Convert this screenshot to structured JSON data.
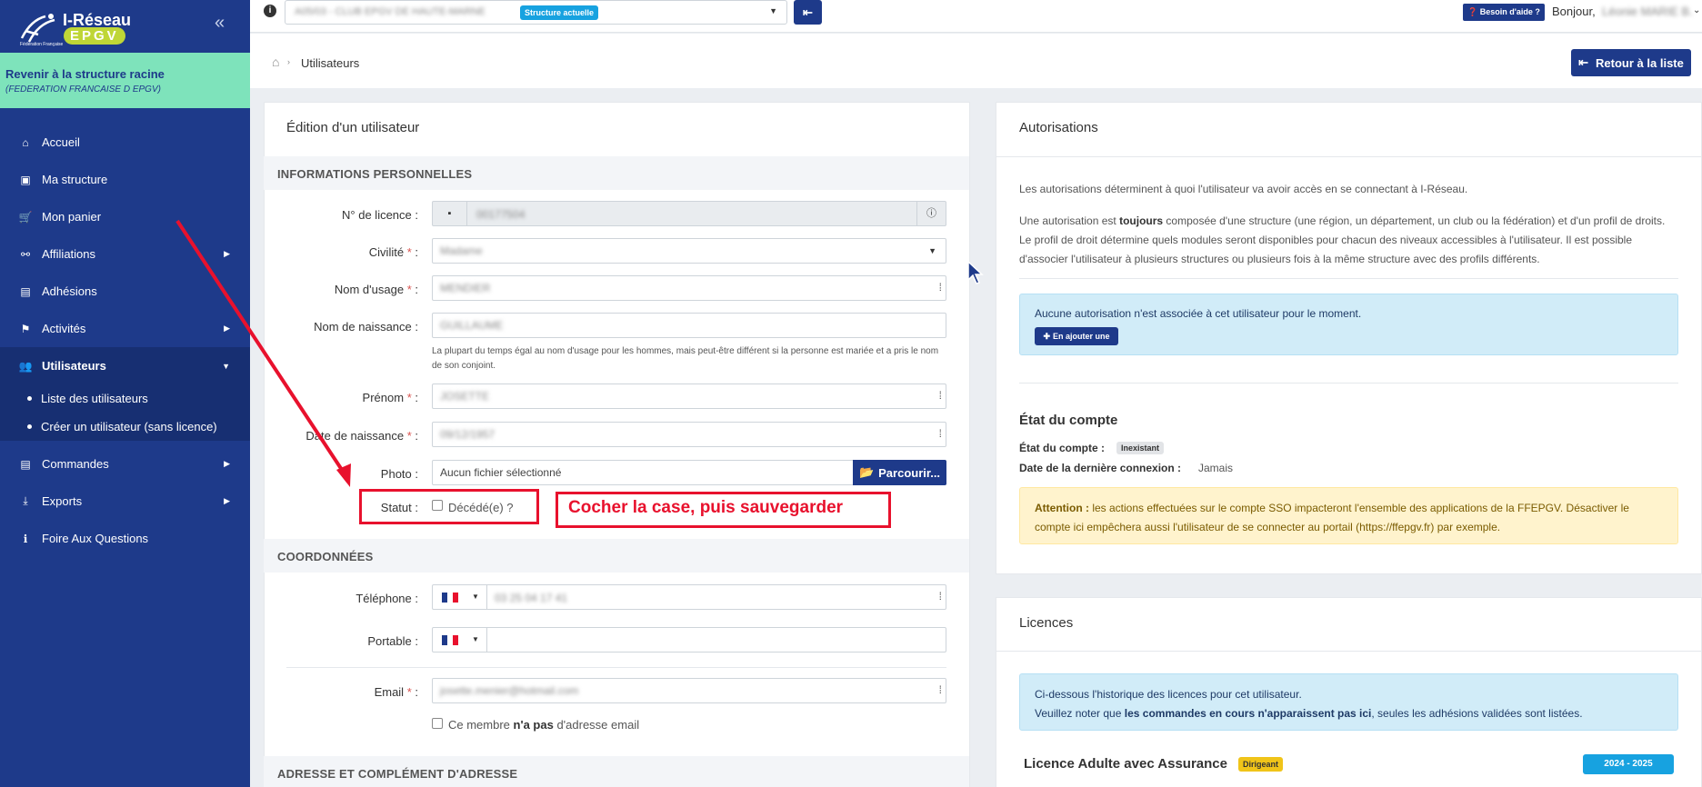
{
  "brand": {
    "name": "I-Réseau",
    "sub": "EPGV",
    "fed": "Fédération Française"
  },
  "sidebar": {
    "back_title": "Revenir à la structure racine",
    "back_sub": "(FEDERATION FRANCAISE D EPGV)",
    "items": [
      {
        "label": "Accueil",
        "icon": "home-icon",
        "glyph": "⌂"
      },
      {
        "label": "Ma structure",
        "icon": "id-card-icon",
        "glyph": "▣"
      },
      {
        "label": "Mon panier",
        "icon": "cart-icon",
        "glyph": "🛒"
      },
      {
        "label": "Affiliations",
        "icon": "sitemap-icon",
        "glyph": "⚯"
      },
      {
        "label": "Adhésions",
        "icon": "card-icon",
        "glyph": "▤"
      },
      {
        "label": "Activités",
        "icon": "running-icon",
        "glyph": "⚑"
      },
      {
        "label": "Utilisateurs",
        "icon": "users-icon",
        "glyph": "👥"
      },
      {
        "label": "Commandes",
        "icon": "list-icon",
        "glyph": "▤"
      },
      {
        "label": "Exports",
        "icon": "download-icon",
        "glyph": "⤓"
      },
      {
        "label": "Foire Aux Questions",
        "icon": "info-icon",
        "glyph": "ℹ"
      }
    ],
    "sub_items": [
      "Liste des utilisateurs",
      "Créer un utilisateur (sans licence)"
    ]
  },
  "topbar": {
    "structure_value": "A05/03 - CLUB EPGV DE HAUTE-MARNE",
    "structure_badge": "Structure actuelle",
    "help_label": "Besoin d'aide ?",
    "greeting": "Bonjour,",
    "user_name": "Léonie MARIE B."
  },
  "breadcrumb": {
    "page": "Utilisateurs"
  },
  "back_to_list": "Retour à la liste",
  "edit": {
    "title": "Édition d'un utilisateur",
    "section_personal": "INFORMATIONS PERSONNELLES",
    "licence_label": "N° de licence :",
    "licence_value": "00177504",
    "civilite_label": "Civilité",
    "civilite_value": "Madame",
    "nom_usage_label": "Nom d'usage",
    "nom_usage_value": "MENDIER",
    "nom_naissance_label": "Nom de naissance :",
    "nom_naissance_value": "GUILLAUME",
    "help_text": "La plupart du temps égal au nom d'usage pour les hommes, mais peut-être différent si la personne est mariée et a pris le nom de son conjoint.",
    "prenom_label": "Prénom",
    "prenom_value": "JOSETTE",
    "naissance_label": "Date de naissance",
    "naissance_value": "09/12/1957",
    "photo_label": "Photo :",
    "photo_value": "Aucun fichier sélectionné",
    "browse_label": "Parcourir...",
    "statut_label": "Statut :",
    "decede_label": "Décédé(e) ?",
    "annotation": "Cocher la case, puis sauvegarder",
    "section_coord": "COORDONNÉES",
    "tel_label": "Téléphone :",
    "tel_value": "03 25 04 17 41",
    "portable_label": "Portable :",
    "email_label": "Email",
    "email_value": "josette.menier@hotmail.com",
    "no_email_pre": "Ce membre",
    "no_email_bold": "n'a pas",
    "no_email_post": "d'adresse email",
    "section_address": "ADRESSE ET COMPLÉMENT D'ADRESSE"
  },
  "auth": {
    "title": "Autorisations",
    "p1": "Les autorisations déterminent à quoi l'utilisateur va avoir accès en se connectant à I-Réseau.",
    "p2a": "Une autorisation est",
    "p2b": "toujours",
    "p2c": "composée d'une structure (une région, un département, un club ou la fédération) et d'un profil de droits. Le profil de droit détermine quels modules seront disponibles pour chacun des niveaux accessibles à l'utilisateur. Il est possible d'associer l'utilisateur à plusieurs structures ou plusieurs fois à la même structure avec des profils différents.",
    "none": "Aucune autorisation n'est associée à cet utilisateur pour le moment.",
    "add": "En ajouter une",
    "account_title": "État du compte",
    "account_state_label": "État du compte :",
    "account_state": "Inexistant",
    "last_login_label": "Date de la dernière connexion :",
    "last_login": "Jamais",
    "warn_bold": "Attention :",
    "warn_text": "les actions effectuées sur le compte SSO impacteront l'ensemble des applications de la FFEPGV. Désactiver le compte ici empêchera aussi l'utilisateur de se connecter au portail (https://ffepgv.fr) par exemple."
  },
  "licences": {
    "title": "Licences",
    "info1": "Ci-dessous l'historique des licences pour cet utilisateur.",
    "info2a": "Veuillez noter que",
    "info2b": "les commandes en cours n'apparaissent pas ici",
    "info2c": ", seules les adhésions validées sont listées.",
    "licence_name": "Licence Adulte avec Assurance",
    "badge": "Dirigeant",
    "season": "2024 - 2025"
  },
  "colors": {
    "navy": "#1e3a8a",
    "mint": "#7ee3bb",
    "annot_red": "#e8112d",
    "info_blue": "#d1ecf8",
    "warn_yellow": "#fff3cd"
  }
}
